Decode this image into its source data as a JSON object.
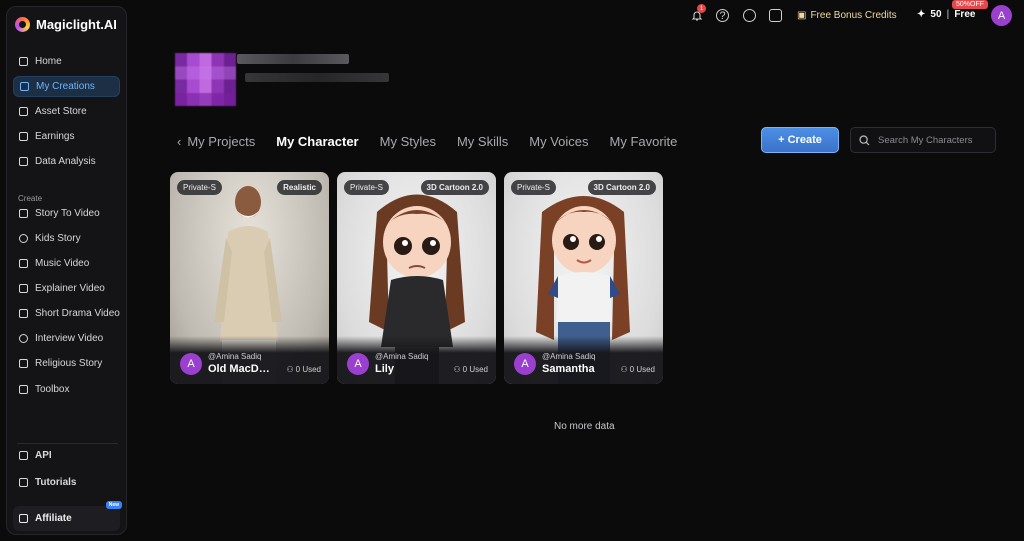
{
  "app": {
    "name": "Magiclight.AI"
  },
  "sidebar": {
    "main_items": [
      {
        "label": "Home",
        "icon": "home-icon"
      },
      {
        "label": "My Creations",
        "icon": "folder-icon",
        "active": true
      },
      {
        "label": "Asset Store",
        "icon": "store-icon"
      },
      {
        "label": "Earnings",
        "icon": "wallet-icon"
      },
      {
        "label": "Data Analysis",
        "icon": "chart-icon"
      }
    ],
    "create_label": "Create",
    "create_items": [
      {
        "label": "Story To Video",
        "icon": "video-icon"
      },
      {
        "label": "Kids Story",
        "icon": "kids-icon"
      },
      {
        "label": "Music Video",
        "icon": "music-icon"
      },
      {
        "label": "Explainer Video",
        "icon": "explainer-icon"
      },
      {
        "label": "Short Drama Video",
        "icon": "drama-icon"
      },
      {
        "label": "Interview Video",
        "icon": "mic-icon"
      },
      {
        "label": "Religious Story",
        "icon": "book-icon"
      },
      {
        "label": "Toolbox",
        "icon": "toolbox-icon"
      }
    ],
    "bottom_items": [
      {
        "label": "API",
        "icon": "api-icon"
      },
      {
        "label": "Tutorials",
        "icon": "tutorial-icon"
      }
    ],
    "affiliate": {
      "label": "Affiliate",
      "badge": "New"
    }
  },
  "topbar": {
    "notification_count": "1",
    "bonus_label": "Free Bonus Credits",
    "credits": "50",
    "plan": "Free",
    "discount_badge": "50%OFF",
    "avatar_letter": "A"
  },
  "tabs": {
    "back": "‹",
    "items": [
      "My Projects",
      "My Character",
      "My Styles",
      "My Skills",
      "My Voices",
      "My Favorite"
    ],
    "active": "My Character"
  },
  "create_button": "+ Create",
  "search": {
    "placeholder": "Search My Characters",
    "value": ""
  },
  "characters": [
    {
      "visibility": "Private-S",
      "style": "Realistic",
      "author": "@Amina Sadiq",
      "name": "Old MacDonald",
      "used": "0 Used",
      "avatar": "A"
    },
    {
      "visibility": "Private-S",
      "style": "3D Cartoon 2.0",
      "author": "@Amina Sadiq",
      "name": "Lily",
      "used": "0 Used",
      "avatar": "A"
    },
    {
      "visibility": "Private-S",
      "style": "3D Cartoon 2.0",
      "author": "@Amina Sadiq",
      "name": "Samantha",
      "used": "0 Used",
      "avatar": "A"
    }
  ],
  "footer_text": "No more data",
  "colors": {
    "accent": "#3b82f6",
    "active_nav_bg": "#1d2f45",
    "avatar": "#9b3fcf",
    "badge_red": "#e5484d"
  }
}
